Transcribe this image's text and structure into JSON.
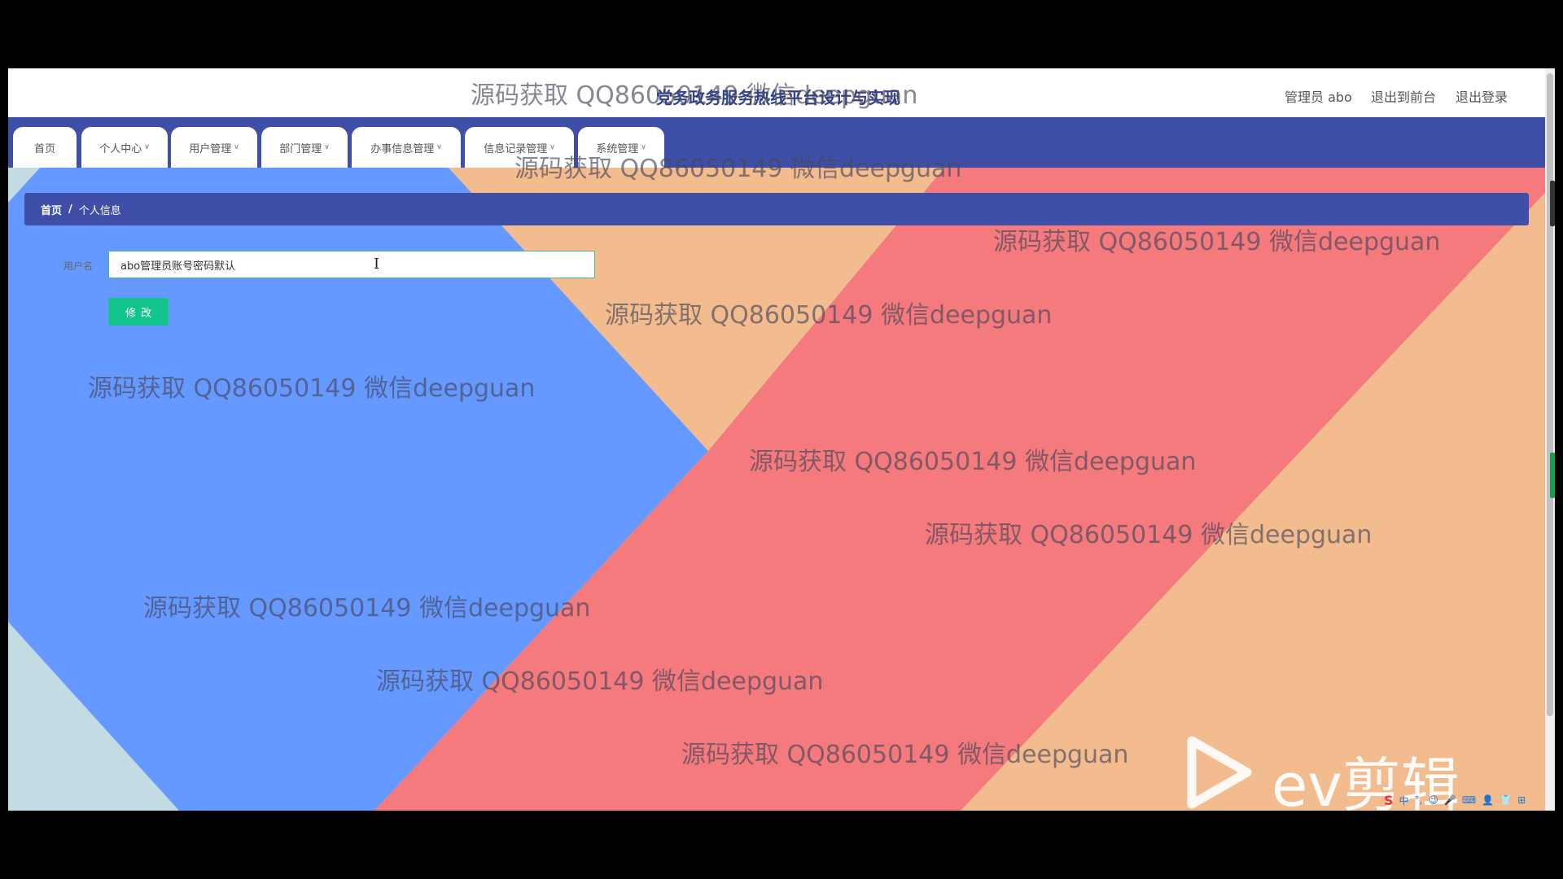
{
  "header": {
    "site_title": "党务政务服务热线平台设计与实现",
    "admin_label": "管理员 abo",
    "back_to_front": "退出到前台",
    "logout": "退出登录"
  },
  "nav": {
    "items": [
      {
        "label": "首页",
        "has_dropdown": false
      },
      {
        "label": "个人中心",
        "has_dropdown": true
      },
      {
        "label": "用户管理",
        "has_dropdown": true
      },
      {
        "label": "部门管理",
        "has_dropdown": true
      },
      {
        "label": "办事信息管理",
        "has_dropdown": true
      },
      {
        "label": "信息记录管理",
        "has_dropdown": true
      },
      {
        "label": "系统管理",
        "has_dropdown": true
      }
    ],
    "chevron_icon": "chevron-down-icon"
  },
  "breadcrumb": {
    "home": "首页",
    "separator": "/",
    "current": "个人信息"
  },
  "form": {
    "username_label": "用户名",
    "username_value": "abo管理员账号密码默认",
    "submit_label": "修改"
  },
  "watermark": "源码获取 QQ86050149 微信deepguan",
  "overlay": {
    "ev_logo_text": "ev剪辑",
    "ime_status": [
      "中",
      "°,",
      "☺",
      "🎤",
      "⌨",
      "👤",
      "👕",
      "⊞"
    ]
  },
  "colors": {
    "primary": "#3f4fa8",
    "button": "#14c48f",
    "bg_blue": "#6699ff",
    "bg_red": "#f47a7d",
    "bg_peach": "#f3bc8f",
    "bg_teal": "#c3dce3"
  }
}
